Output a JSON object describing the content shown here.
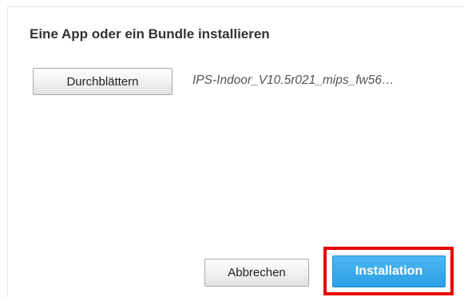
{
  "dialog": {
    "title": "Eine App oder ein Bundle installieren",
    "browse_label": "Durchblättern",
    "selected_file": "IPS-Indoor_V10.5r021_mips_fw56…",
    "cancel_label": "Abbrechen",
    "install_label": "Installation"
  },
  "colors": {
    "install_button": "#2a9ee6",
    "highlight_border": "#e60000",
    "title_text": "#333333"
  }
}
